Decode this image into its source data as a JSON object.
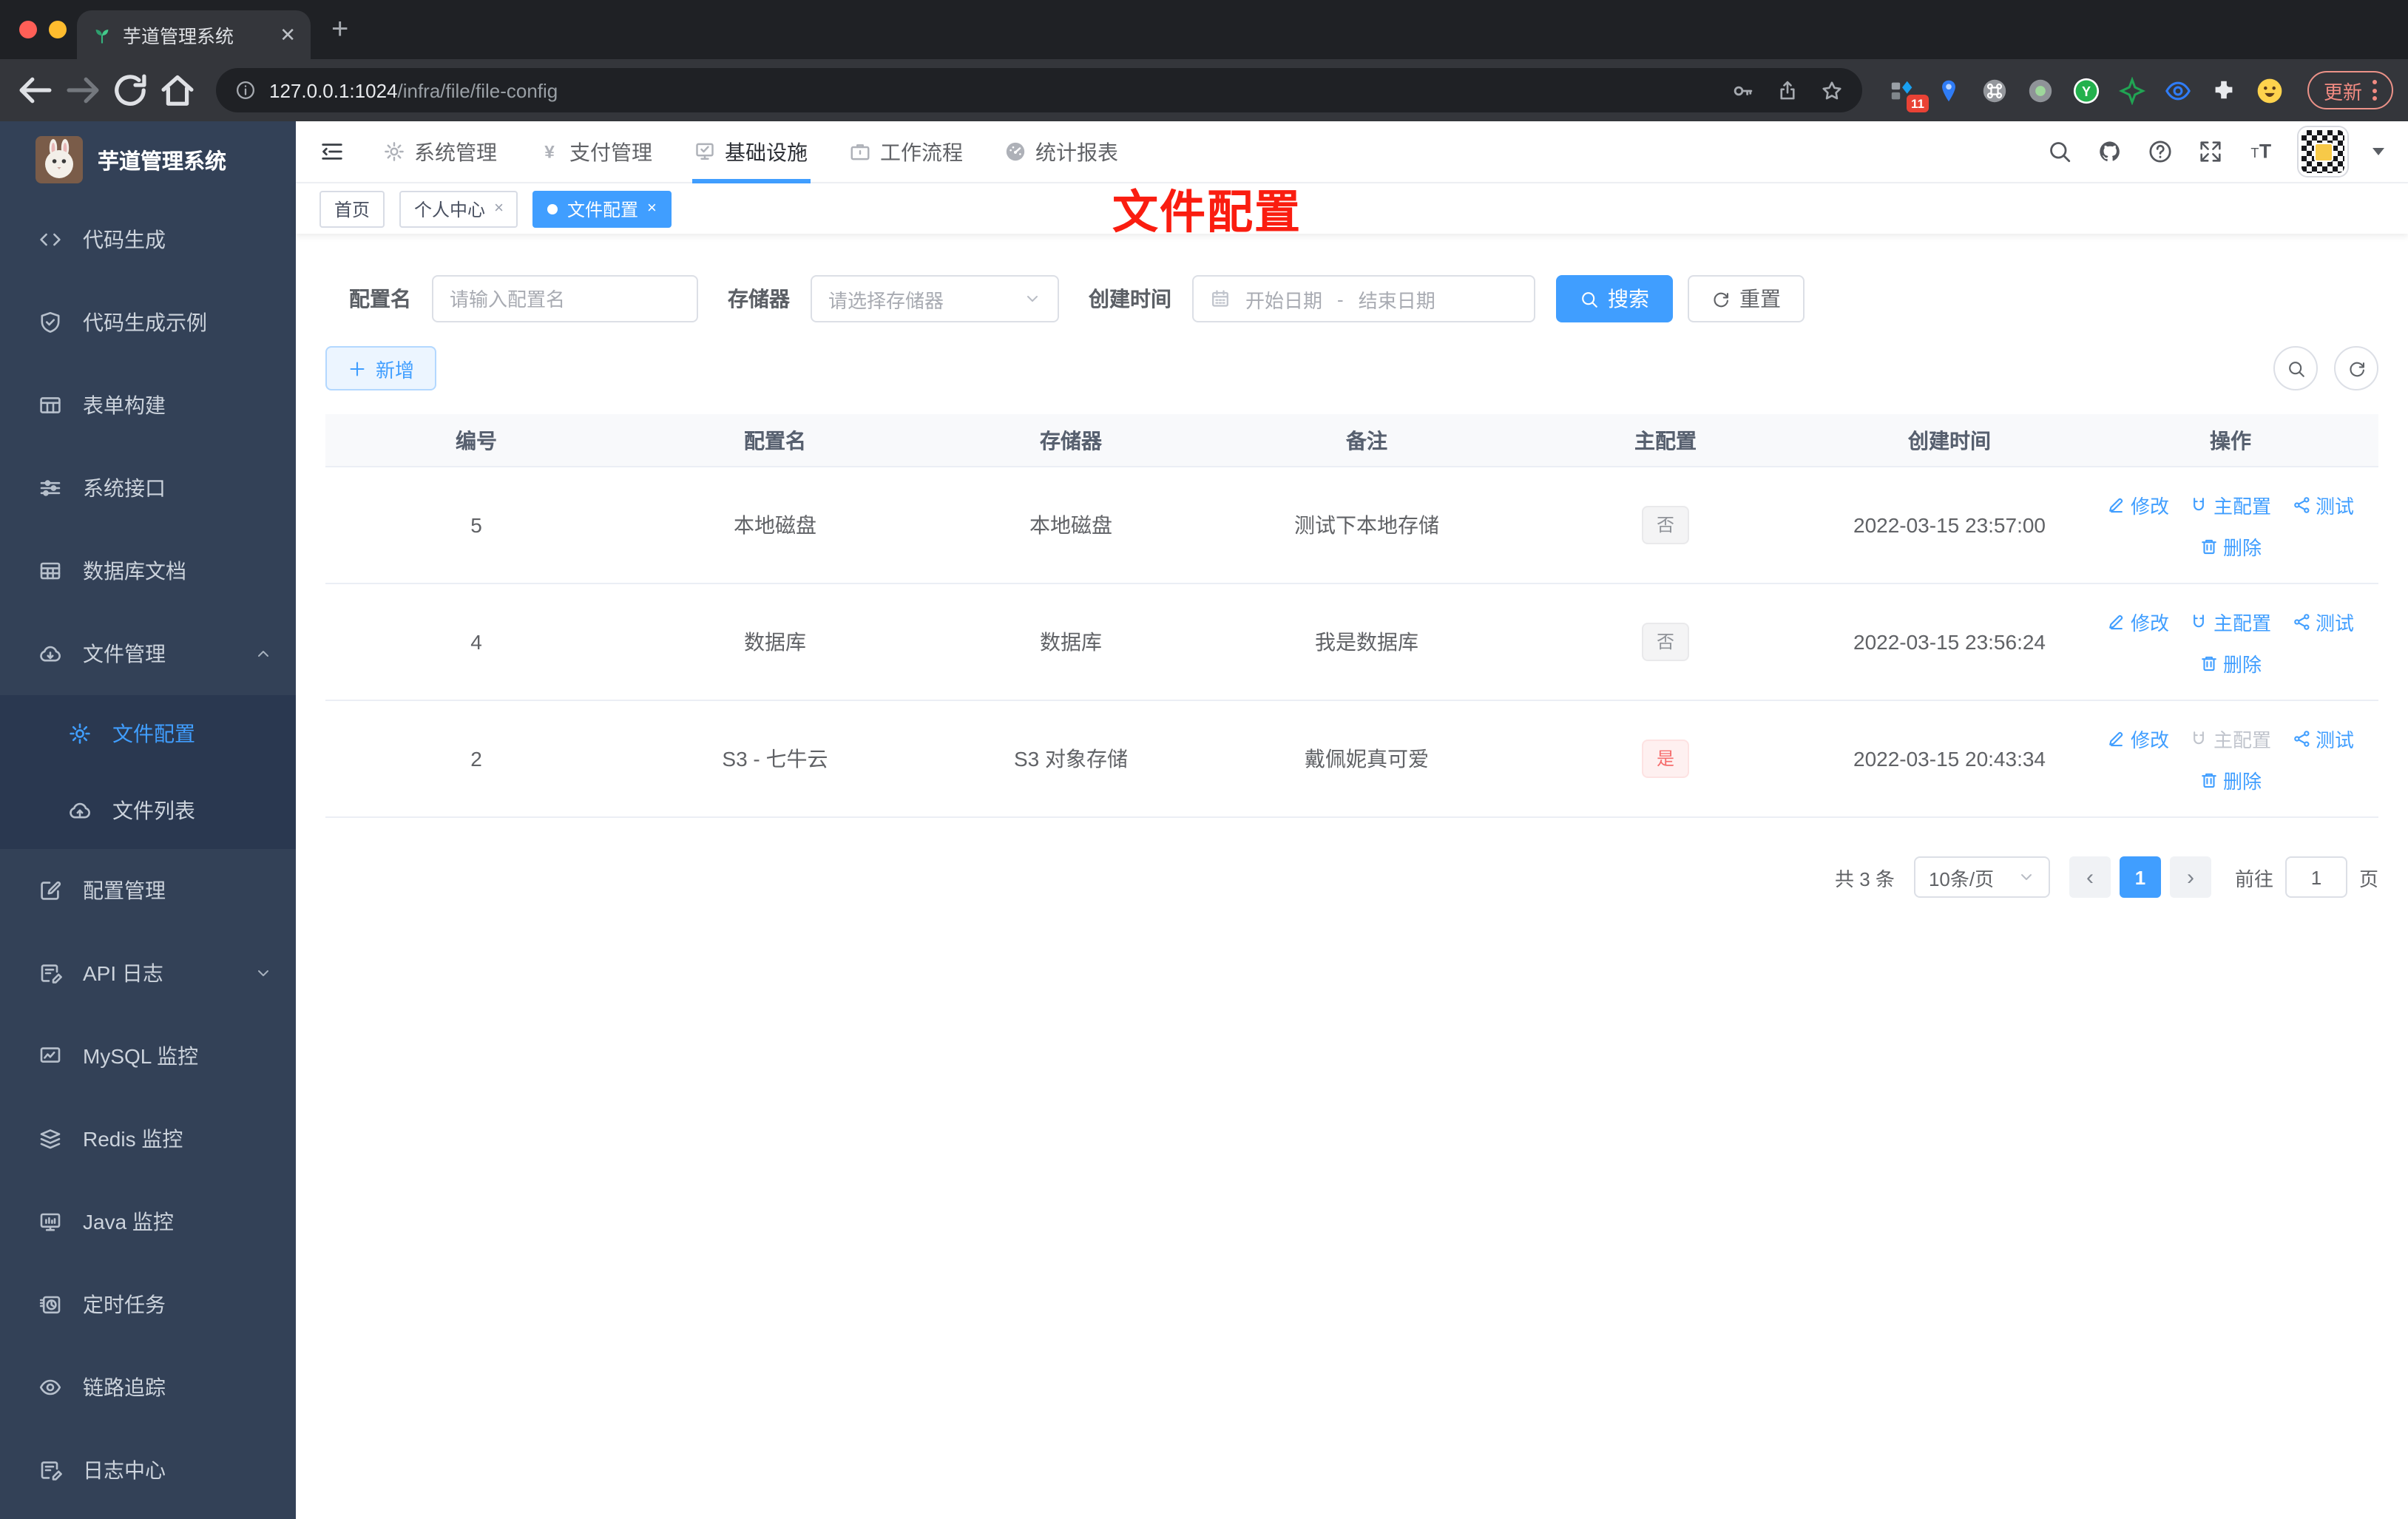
{
  "colors": {
    "accent": "#409eff",
    "danger": "#f56c6c",
    "sidebar_bg": "#334157",
    "overlay_red": "#fa1d10"
  },
  "browser": {
    "tab_title": "芋道管理系统",
    "new_tab_label": "+",
    "url_host": "127.0.0.1:1024",
    "url_path": "/infra/file/file-config",
    "extension_badge": "11",
    "update_label": "更新"
  },
  "sidebar": {
    "app_title": "芋道管理系统",
    "items": [
      {
        "key": "code-gen",
        "icon": "code",
        "label": "代码生成"
      },
      {
        "key": "code-gen-demo",
        "icon": "shield",
        "label": "代码生成示例"
      },
      {
        "key": "form-builder",
        "icon": "table",
        "label": "表单构建"
      },
      {
        "key": "system-api",
        "icon": "sliders",
        "label": "系统接口"
      },
      {
        "key": "db-doc",
        "icon": "grid",
        "label": "数据库文档"
      },
      {
        "key": "file-manage",
        "icon": "cloud-down",
        "label": "文件管理",
        "expanded": true,
        "children": [
          {
            "key": "file-config",
            "icon": "gear",
            "label": "文件配置",
            "active": true
          },
          {
            "key": "file-list",
            "icon": "cloud-up",
            "label": "文件列表"
          }
        ]
      },
      {
        "key": "config-manage",
        "icon": "edit-square",
        "label": "配置管理"
      },
      {
        "key": "api-log",
        "icon": "doc-edit",
        "label": "API 日志",
        "collapsible": true
      },
      {
        "key": "mysql-monitor",
        "icon": "chart-monitor",
        "label": "MySQL 监控"
      },
      {
        "key": "redis-monitor",
        "icon": "layers",
        "label": "Redis 监控"
      },
      {
        "key": "java-monitor",
        "icon": "monitor",
        "label": "Java 监控"
      },
      {
        "key": "scheduled-job",
        "icon": "clock",
        "label": "定时任务"
      },
      {
        "key": "trace",
        "icon": "eye",
        "label": "链路追踪"
      },
      {
        "key": "log-center",
        "icon": "doc-edit",
        "label": "日志中心"
      }
    ]
  },
  "topnav": {
    "items": [
      {
        "key": "system",
        "icon": "gear",
        "label": "系统管理"
      },
      {
        "key": "pay",
        "icon": "yen",
        "label": "支付管理"
      },
      {
        "key": "infra",
        "icon": "infra",
        "label": "基础设施",
        "active": true
      },
      {
        "key": "workflow",
        "icon": "briefcase",
        "label": "工作流程"
      },
      {
        "key": "report",
        "icon": "gauge",
        "label": "统计报表"
      }
    ]
  },
  "tags": [
    {
      "key": "home",
      "label": "首页"
    },
    {
      "key": "profile",
      "label": "个人中心",
      "closable": true
    },
    {
      "key": "file-config",
      "label": "文件配置",
      "closable": true,
      "active": true
    }
  ],
  "overlay_label": "文件配置",
  "filters": {
    "name_label": "配置名",
    "name_placeholder": "请输入配置名",
    "storage_label": "存储器",
    "storage_placeholder": "请选择存储器",
    "time_label": "创建时间",
    "start_placeholder": "开始日期",
    "range_separator": "-",
    "end_placeholder": "结束日期",
    "search_label": "搜索",
    "reset_label": "重置",
    "add_label": "新增"
  },
  "table": {
    "headers": [
      "编号",
      "配置名",
      "存储器",
      "备注",
      "主配置",
      "创建时间",
      "操作"
    ],
    "action_labels": {
      "edit": "修改",
      "master": "主配置",
      "test": "测试",
      "delete": "删除"
    },
    "rows": [
      {
        "id": "5",
        "name": "本地磁盘",
        "storage": "本地磁盘",
        "remark": "测试下本地存储",
        "master": "否",
        "master_type": "info",
        "created": "2022-03-15 23:57:00",
        "master_action_disabled": false
      },
      {
        "id": "4",
        "name": "数据库",
        "storage": "数据库",
        "remark": "我是数据库",
        "master": "否",
        "master_type": "info",
        "created": "2022-03-15 23:56:24",
        "master_action_disabled": false
      },
      {
        "id": "2",
        "name": "S3 - 七牛云",
        "storage": "S3 对象存储",
        "remark": "戴佩妮真可爱",
        "master": "是",
        "master_type": "danger",
        "created": "2022-03-15 20:43:34",
        "master_action_disabled": true
      }
    ]
  },
  "pagination": {
    "total": "共 3 条",
    "page_size": "10条/页",
    "prev": "‹",
    "current_page": "1",
    "next": "›",
    "goto_label": "前往",
    "goto_value": "1",
    "page_unit": "页"
  }
}
